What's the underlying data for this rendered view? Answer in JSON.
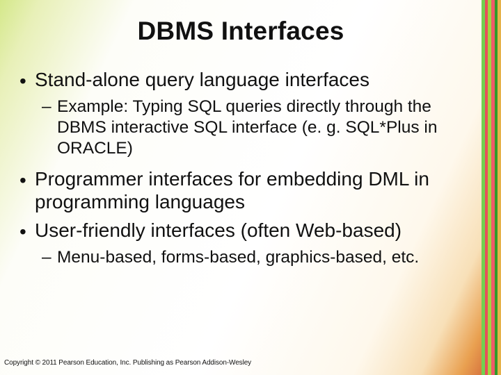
{
  "title": "DBMS Interfaces",
  "bullets": {
    "b1": "Stand-alone query language interfaces",
    "b1_sub1": "Example: Typing SQL queries directly through the DBMS interactive SQL interface (e. g. SQL*Plus in ORACLE)",
    "b2": "Programmer interfaces for embedding DML in programming languages",
    "b3": "User-friendly interfaces (often Web-based)",
    "b3_sub1": "Menu-based, forms-based, graphics-based, etc."
  },
  "copyright": "Copyright © 2011 Pearson Education, Inc. Publishing as Pearson Addison-Wesley"
}
